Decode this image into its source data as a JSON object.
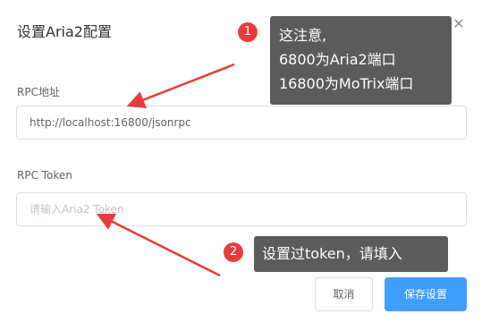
{
  "dialog": {
    "title": "设置Aria2配置",
    "close_icon": "close-icon"
  },
  "form": {
    "rpc_label": "RPC地址",
    "rpc_value": "http://localhost:16800/jsonrpc",
    "token_label": "RPC Token",
    "token_placeholder": "请输入Aria2 Token"
  },
  "buttons": {
    "cancel": "取消",
    "save": "保存设置"
  },
  "annotations": {
    "badge1": "1",
    "callout1_line1": "这注意,",
    "callout1_line2": "6800为Aria2端口",
    "callout1_line3": "16800为MoTrix端口",
    "badge2": "2",
    "callout2": "设置过token，请填入"
  },
  "colors": {
    "primary": "#409eff",
    "annotation_red": "#e83c3c",
    "callout_bg": "#5b5b5b"
  }
}
